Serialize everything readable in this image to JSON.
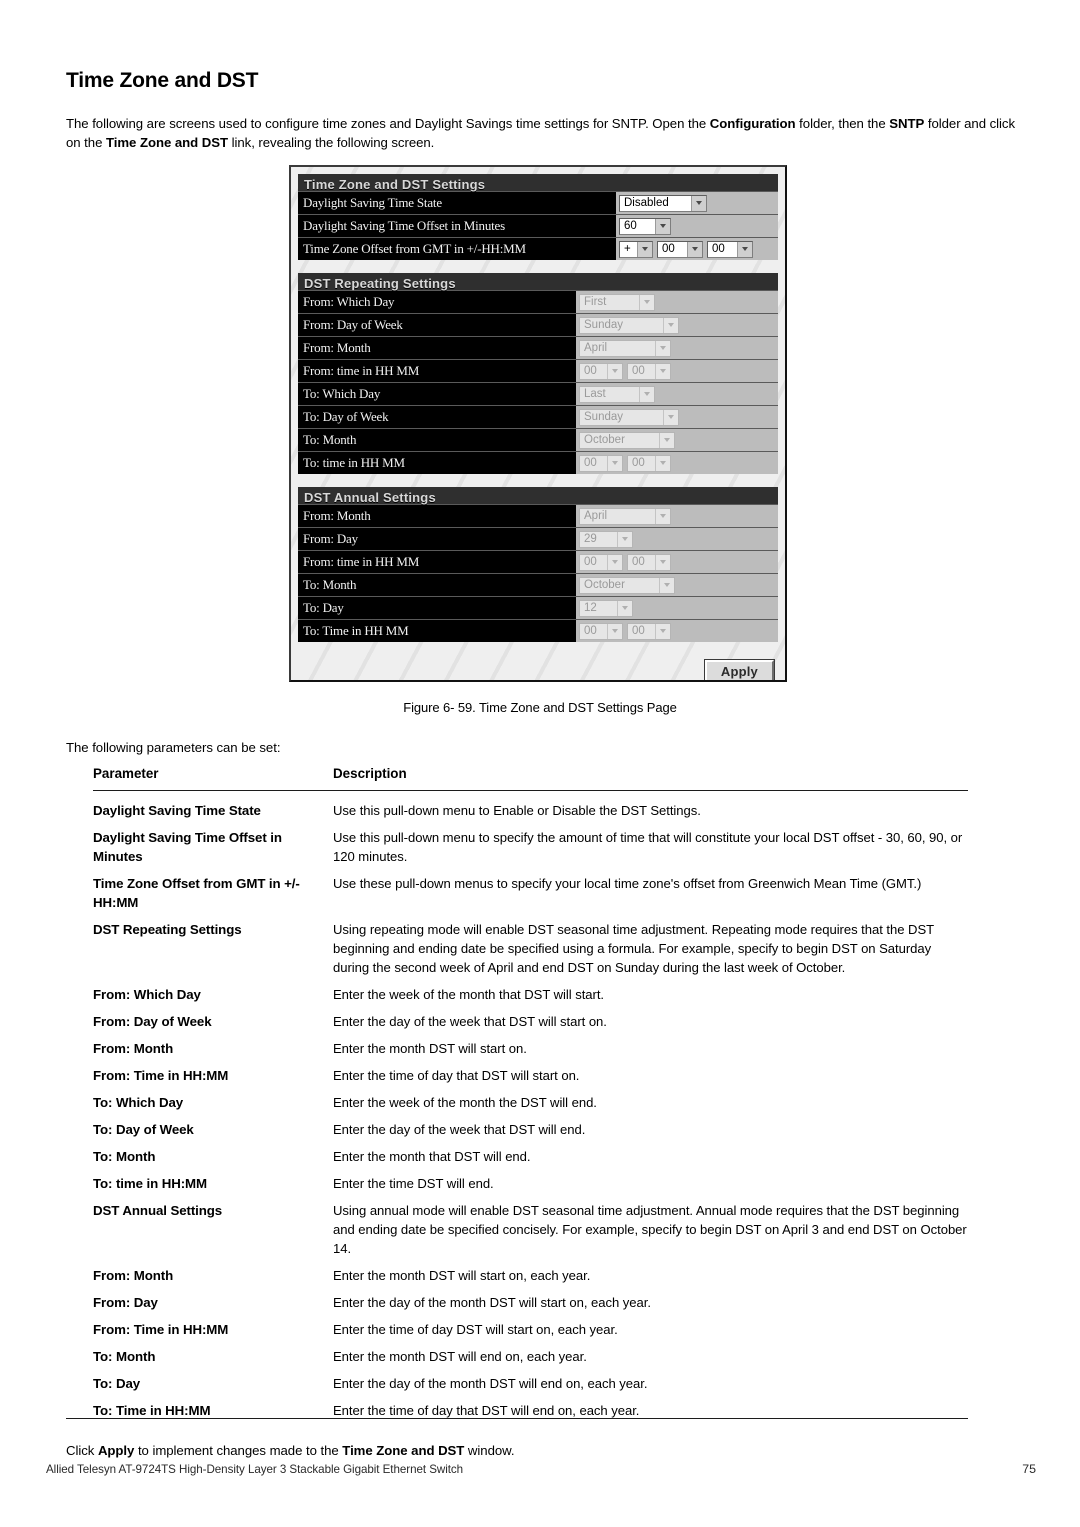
{
  "page_title": "Time Zone and DST",
  "intro": {
    "part1": "The following are screens used to configure time zones and Daylight Savings time settings for SNTP. Open the ",
    "bold1": "Configuration",
    "part2": " folder, then the ",
    "bold2": "SNTP",
    "part3": " folder and click on the ",
    "bold3": "Time Zone and DST",
    "part4": " link, revealing the following screen."
  },
  "screenshot": {
    "sections": [
      {
        "title": "Time Zone and DST Settings",
        "rows": [
          {
            "label": "Daylight Saving Time State",
            "controls": [
              {
                "value": "Disabled",
                "width": "w-disabled",
                "disabled": false
              }
            ]
          },
          {
            "label": "Daylight Saving Time Offset in Minutes",
            "controls": [
              {
                "value": "60",
                "width": "w-60",
                "disabled": false
              }
            ]
          },
          {
            "label": "Time Zone Offset from GMT in +/-HH:MM",
            "controls": [
              {
                "value": "+",
                "width": "w-sign",
                "disabled": false
              },
              {
                "value": "00",
                "width": "w-num",
                "disabled": false
              },
              {
                "value": "00",
                "width": "w-num",
                "disabled": false
              }
            ]
          }
        ]
      },
      {
        "title": "DST Repeating Settings",
        "rows": [
          {
            "label": "From: Which Day",
            "controls": [
              {
                "value": "First",
                "width": "w-first",
                "disabled": true
              }
            ]
          },
          {
            "label": "From: Day of Week",
            "controls": [
              {
                "value": "Sunday",
                "width": "w-sunday",
                "disabled": true
              }
            ]
          },
          {
            "label": "From: Month",
            "controls": [
              {
                "value": "April",
                "width": "w-april",
                "disabled": true
              }
            ]
          },
          {
            "label": "From: time in HH MM",
            "controls": [
              {
                "value": "00",
                "width": "w-hh",
                "disabled": true
              },
              {
                "value": "00",
                "width": "w-hh",
                "disabled": true
              }
            ]
          },
          {
            "label": "To: Which Day",
            "controls": [
              {
                "value": "Last",
                "width": "w-last",
                "disabled": true
              }
            ]
          },
          {
            "label": "To: Day of Week",
            "controls": [
              {
                "value": "Sunday",
                "width": "w-sunday",
                "disabled": true
              }
            ]
          },
          {
            "label": "To: Month",
            "controls": [
              {
                "value": "October",
                "width": "w-oct",
                "disabled": true
              }
            ]
          },
          {
            "label": "To: time in HH MM",
            "controls": [
              {
                "value": "00",
                "width": "w-hh",
                "disabled": true
              },
              {
                "value": "00",
                "width": "w-hh",
                "disabled": true
              }
            ]
          }
        ]
      },
      {
        "title": "DST Annual Settings",
        "rows": [
          {
            "label": "From: Month",
            "controls": [
              {
                "value": "April",
                "width": "w-april",
                "disabled": true
              }
            ]
          },
          {
            "label": "From: Day",
            "controls": [
              {
                "value": "29",
                "width": "w-day",
                "disabled": true
              }
            ]
          },
          {
            "label": "From: time in HH MM",
            "controls": [
              {
                "value": "00",
                "width": "w-hh",
                "disabled": true
              },
              {
                "value": "00",
                "width": "w-hh",
                "disabled": true
              }
            ]
          },
          {
            "label": "To: Month",
            "controls": [
              {
                "value": "October",
                "width": "w-oct",
                "disabled": true
              }
            ]
          },
          {
            "label": "To: Day",
            "controls": [
              {
                "value": "12",
                "width": "w-day",
                "disabled": true
              }
            ]
          },
          {
            "label": "To: Time in HH MM",
            "controls": [
              {
                "value": "00",
                "width": "w-hh",
                "disabled": true
              },
              {
                "value": "00",
                "width": "w-hh",
                "disabled": true
              }
            ]
          }
        ]
      }
    ],
    "apply_label": "Apply"
  },
  "figure_caption": "Figure 6- 59. Time Zone and DST Settings Page",
  "lead_in": "The following parameters can be set:",
  "table": {
    "headers": {
      "parameter": "Parameter",
      "description": "Description"
    },
    "rows": [
      {
        "parameter": "Daylight Saving Time State",
        "description": "Use this pull-down menu to Enable or Disable the DST Settings."
      },
      {
        "parameter": "Daylight Saving Time Offset in Minutes",
        "description": "Use this pull-down menu to specify the amount of time that will constitute your local DST offset - 30, 60, 90, or 120 minutes."
      },
      {
        "parameter": "Time Zone Offset from GMT in +/- HH:MM",
        "description": "Use these pull-down menus to specify your local time zone's offset from Greenwich Mean Time (GMT.)"
      },
      {
        "parameter": "DST Repeating Settings",
        "description": "Using repeating mode will enable DST seasonal time adjustment. Repeating mode requires that the DST beginning and ending date be specified using a formula. For example, specify to begin DST on Saturday during the second week of April and end DST on Sunday during the last week of October."
      },
      {
        "parameter": "From: Which Day",
        "description": "Enter the week of the month that DST will start."
      },
      {
        "parameter": "From: Day of Week",
        "description": "Enter the day of the week that DST will start on."
      },
      {
        "parameter": "From: Month",
        "description": "Enter the month DST will start on."
      },
      {
        "parameter": "From: Time in HH:MM",
        "description": "Enter the time of day that DST will start on."
      },
      {
        "parameter": "To: Which Day",
        "description": "Enter the week of the month the DST will end."
      },
      {
        "parameter": "To: Day of Week",
        "description": "Enter the day of the week that DST will end."
      },
      {
        "parameter": "To: Month",
        "description": "Enter the month that DST will end."
      },
      {
        "parameter": "To: time in HH:MM",
        "description": "Enter the time DST will end."
      },
      {
        "parameter": "DST Annual Settings",
        "description": "Using annual mode will enable DST seasonal time adjustment. Annual mode requires that the DST beginning and ending date be specified concisely. For example, specify to begin DST on April 3 and end DST on October 14."
      },
      {
        "parameter": "From: Month",
        "description": "Enter the month DST will start on, each year."
      },
      {
        "parameter": "From: Day",
        "description": "Enter the day of the month DST will start on, each year."
      },
      {
        "parameter": "From: Time in HH:MM",
        "description": "Enter the time of day DST will start on, each year."
      },
      {
        "parameter": "To: Month",
        "description": "Enter the month DST will end on, each year."
      },
      {
        "parameter": "To: Day",
        "description": "Enter the day of the month DST will end on, each year."
      },
      {
        "parameter": "To: Time in HH:MM",
        "description": "Enter the time of day that DST will end on, each year."
      }
    ]
  },
  "closing": {
    "part1": "Click ",
    "bold1": "Apply",
    "part2": " to implement changes made to the ",
    "bold2": "Time Zone and DST",
    "part3": " window."
  },
  "footer": {
    "left": "Allied Telesyn AT-9724TS High-Density Layer 3 Stackable Gigabit Ethernet Switch",
    "page_number": "75"
  }
}
